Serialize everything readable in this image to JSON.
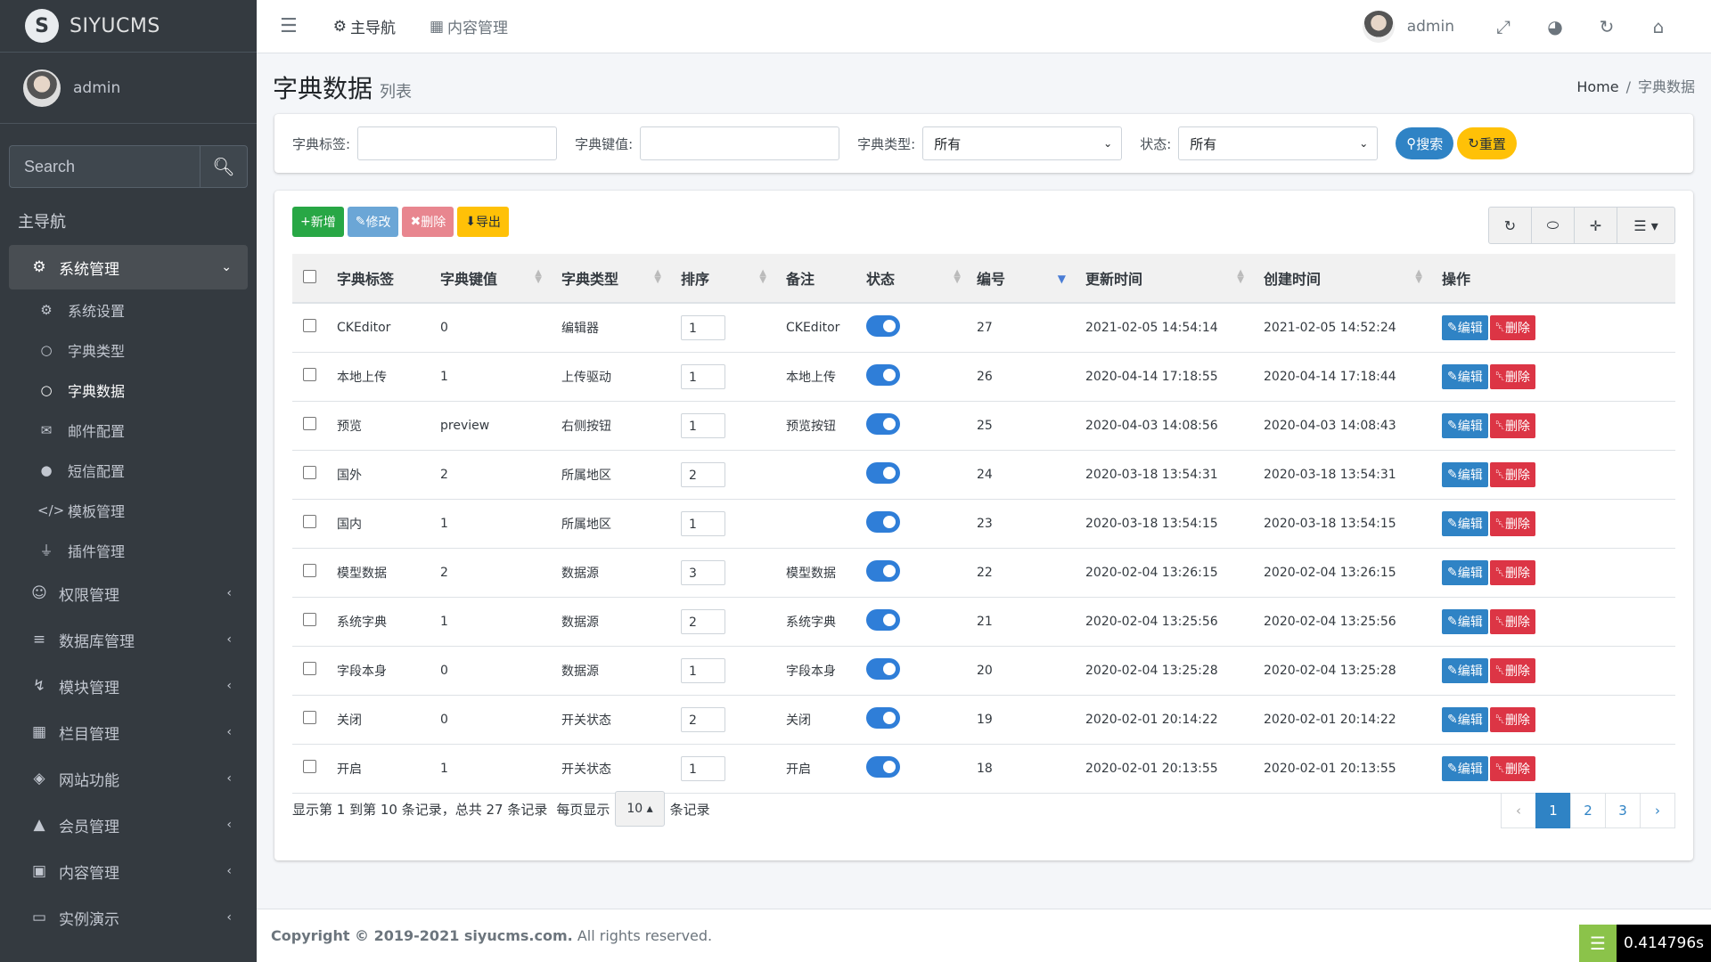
{
  "brand": {
    "logo_letter": "S",
    "name": "SIYUCMS"
  },
  "user": {
    "name": "admin"
  },
  "sidebar": {
    "search_placeholder": "Search",
    "header": "主导航",
    "items": [
      {
        "label": "系统管理",
        "icon": "cogs-icon",
        "expanded": true,
        "children": [
          {
            "label": "系统设置",
            "icon": "cog-icon"
          },
          {
            "label": "字典类型",
            "icon": "circle-icon"
          },
          {
            "label": "字典数据",
            "icon": "circle-icon",
            "active": true
          },
          {
            "label": "邮件配置",
            "icon": "envelope-icon"
          },
          {
            "label": "短信配置",
            "icon": "comment-icon"
          },
          {
            "label": "模板管理",
            "icon": "code-icon"
          },
          {
            "label": "插件管理",
            "icon": "plug-icon"
          }
        ]
      },
      {
        "label": "权限管理",
        "icon": "user-cog-icon"
      },
      {
        "label": "数据库管理",
        "icon": "database-icon"
      },
      {
        "label": "模块管理",
        "icon": "bolt-icon"
      },
      {
        "label": "栏目管理",
        "icon": "grid-icon"
      },
      {
        "label": "网站功能",
        "icon": "layers-icon"
      },
      {
        "label": "会员管理",
        "icon": "user-icon"
      },
      {
        "label": "内容管理",
        "icon": "briefcase-icon"
      },
      {
        "label": "实例演示",
        "icon": "desktop-icon"
      }
    ]
  },
  "topbar": {
    "nav_main": "主导航",
    "nav_content": "内容管理",
    "user": "admin"
  },
  "page": {
    "title": "字典数据",
    "subtitle": "列表"
  },
  "breadcrumb": {
    "home": "Home",
    "current": "字典数据"
  },
  "filters": {
    "label_tag": "字典标签:",
    "label_value": "字典键值:",
    "label_type": "字典类型:",
    "type_selected": "所有",
    "label_status": "状态:",
    "status_selected": "所有",
    "search_btn": "搜索",
    "reset_btn": "重置"
  },
  "toolbar": {
    "add": "新增",
    "edit": "修改",
    "delete": "删除",
    "export": "导出"
  },
  "table": {
    "columns": [
      "字典标签",
      "字典键值",
      "字典类型",
      "排序",
      "备注",
      "状态",
      "编号",
      "更新时间",
      "创建时间",
      "操作"
    ],
    "edit_label": "编辑",
    "delete_label": "删除",
    "rows": [
      {
        "tag": "CKEditor",
        "value": "0",
        "type": "编辑器",
        "sort": "1",
        "remark": "CKEditor",
        "status": true,
        "id": "27",
        "updated": "2021-02-05 14:54:14",
        "created": "2021-02-05 14:52:24"
      },
      {
        "tag": "本地上传",
        "value": "1",
        "type": "上传驱动",
        "sort": "1",
        "remark": "本地上传",
        "status": true,
        "id": "26",
        "updated": "2020-04-14 17:18:55",
        "created": "2020-04-14 17:18:44"
      },
      {
        "tag": "预览",
        "value": "preview",
        "type": "右侧按钮",
        "sort": "1",
        "remark": "预览按钮",
        "status": true,
        "id": "25",
        "updated": "2020-04-03 14:08:56",
        "created": "2020-04-03 14:08:43"
      },
      {
        "tag": "国外",
        "value": "2",
        "type": "所属地区",
        "sort": "2",
        "remark": "",
        "status": true,
        "id": "24",
        "updated": "2020-03-18 13:54:31",
        "created": "2020-03-18 13:54:31"
      },
      {
        "tag": "国内",
        "value": "1",
        "type": "所属地区",
        "sort": "1",
        "remark": "",
        "status": true,
        "id": "23",
        "updated": "2020-03-18 13:54:15",
        "created": "2020-03-18 13:54:15"
      },
      {
        "tag": "模型数据",
        "value": "2",
        "type": "数据源",
        "sort": "3",
        "remark": "模型数据",
        "status": true,
        "id": "22",
        "updated": "2020-02-04 13:26:15",
        "created": "2020-02-04 13:26:15"
      },
      {
        "tag": "系统字典",
        "value": "1",
        "type": "数据源",
        "sort": "2",
        "remark": "系统字典",
        "status": true,
        "id": "21",
        "updated": "2020-02-04 13:25:56",
        "created": "2020-02-04 13:25:56"
      },
      {
        "tag": "字段本身",
        "value": "0",
        "type": "数据源",
        "sort": "1",
        "remark": "字段本身",
        "status": true,
        "id": "20",
        "updated": "2020-02-04 13:25:28",
        "created": "2020-02-04 13:25:28"
      },
      {
        "tag": "关闭",
        "value": "0",
        "type": "开关状态",
        "sort": "2",
        "remark": "关闭",
        "status": true,
        "id": "19",
        "updated": "2020-02-01 20:14:22",
        "created": "2020-02-01 20:14:22"
      },
      {
        "tag": "开启",
        "value": "1",
        "type": "开关状态",
        "sort": "1",
        "remark": "开启",
        "status": true,
        "id": "18",
        "updated": "2020-02-01 20:13:55",
        "created": "2020-02-01 20:13:55"
      }
    ]
  },
  "pager": {
    "info": "显示第 1 到第 10 条记录，总共 27 条记录",
    "per_page_prefix": "每页显示",
    "per_page": "10",
    "per_page_suffix": "条记录",
    "prev": "‹",
    "pages": [
      "1",
      "2",
      "3"
    ],
    "next": "›"
  },
  "footer": {
    "copyright": "Copyright © 2019-2021 siyucms.com.",
    "rights": "All rights reserved."
  },
  "timer": {
    "value": "0.414796s"
  },
  "colors": {
    "sidebar_bg": "#343a40",
    "primary": "#2f83c5",
    "success": "#28a745",
    "danger": "#dc3545",
    "warning": "#ffc107"
  }
}
